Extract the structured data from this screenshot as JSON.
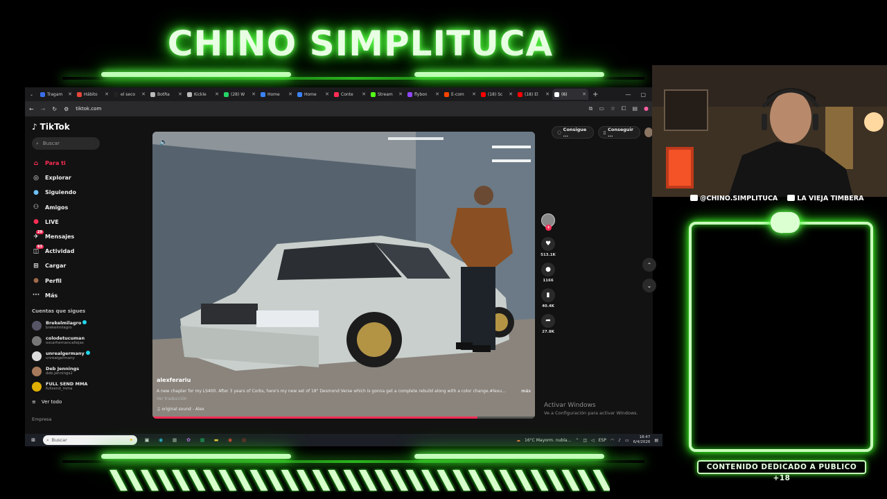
{
  "stream": {
    "title": "CHINO SIMPLITUCA",
    "instagram": "@CHINO.SIMPLITUCA",
    "youtube": "LA VIEJA TIMBERA",
    "adult_notice": "CONTENIDO DEDICADO A PUBLICO +18",
    "accent_color": "#3cff2a"
  },
  "browser": {
    "tabs": [
      {
        "label": "Tragam",
        "color": "#3b6ee8"
      },
      {
        "label": "Hábito",
        "color": "#e8453b"
      },
      {
        "label": "el seco",
        "color": "#222"
      },
      {
        "label": "BotRa",
        "color": "#bbbbbb"
      },
      {
        "label": "Kickle",
        "color": "#bbbbbb"
      },
      {
        "label": "(28) W",
        "color": "#25d366"
      },
      {
        "label": "Home",
        "color": "#3b82f6"
      },
      {
        "label": "Home",
        "color": "#3b82f6"
      },
      {
        "label": "Conte",
        "color": "#ff2c55"
      },
      {
        "label": "Stream",
        "color": "#53fc18"
      },
      {
        "label": "flybon",
        "color": "#9146ff"
      },
      {
        "label": "E-com",
        "color": "#ff4400"
      },
      {
        "label": "(18) Sc",
        "color": "#ff0000"
      },
      {
        "label": "(18) El",
        "color": "#ff0000"
      },
      {
        "label": "(6)",
        "color": "#ffffff"
      }
    ],
    "url": "tiktok.com"
  },
  "tiktok": {
    "logo": "TikTok",
    "search_placeholder": "Buscar",
    "nav": [
      {
        "label": "Para ti",
        "icon": "home-icon",
        "glyph": "⌂",
        "active": true
      },
      {
        "label": "Explorar",
        "icon": "compass-icon",
        "glyph": "◎"
      },
      {
        "label": "Siguiendo",
        "icon": "following-icon",
        "glyph": "●"
      },
      {
        "label": "Amigos",
        "icon": "friends-icon",
        "glyph": "⚇"
      },
      {
        "label": "LIVE",
        "icon": "live-icon",
        "glyph": "●"
      },
      {
        "label": "Mensajes",
        "icon": "messages-icon",
        "glyph": "✈",
        "badge": "29"
      },
      {
        "label": "Actividad",
        "icon": "activity-icon",
        "glyph": "◫",
        "badge": "63"
      },
      {
        "label": "Cargar",
        "icon": "upload-icon",
        "glyph": "⊞"
      },
      {
        "label": "Perfil",
        "icon": "profile-icon",
        "glyph": "●"
      },
      {
        "label": "Más",
        "icon": "more-icon",
        "glyph": "···"
      }
    ],
    "following_header": "Cuentas que sigues",
    "following": [
      {
        "name": "Brekelmilagro",
        "handle": "brekelmilagro",
        "verified": true,
        "color": "#556"
      },
      {
        "name": "colodetucuman",
        "handle": "oscarhernancallejas",
        "verified": false,
        "color": "#777"
      },
      {
        "name": "unrealgermany",
        "handle": "unrealgermany",
        "verified": true,
        "color": "#ddd"
      },
      {
        "name": "Deb Jennings",
        "handle": "deb.jennings2",
        "verified": false,
        "color": "#a67a5b"
      },
      {
        "name": "FULL SEND MMA",
        "handle": "fullsend_mma",
        "verified": false,
        "color": "#e0b000"
      }
    ],
    "see_all": "Ver todo",
    "company": "Empresa",
    "top_buttons": [
      "Consigue ...",
      "Conseguir ..."
    ],
    "video": {
      "username": "alexferariu",
      "caption": "A new chapter for my LS400. After 3 years of Corbs, here's my new set of 18\" Desmond Verse which is gonna get a complete rebuild along with a color change.#lexu...",
      "more": "más",
      "translate": "Ver traducción",
      "sound": "original sound - Alex",
      "progress": 0.85
    },
    "actions": {
      "likes": "513.1K",
      "comments": "1166",
      "saves": "40.4K",
      "shares": "27.8K"
    }
  },
  "windows": {
    "activate_title": "Activar Windows",
    "activate_sub": "Ve a Configuración para activar Windows.",
    "taskbar_search": "Buscar",
    "weather": "16°C  Mayorm. nubla...",
    "lang": "ESP",
    "time": "18:47",
    "date": "6/4/2026"
  }
}
